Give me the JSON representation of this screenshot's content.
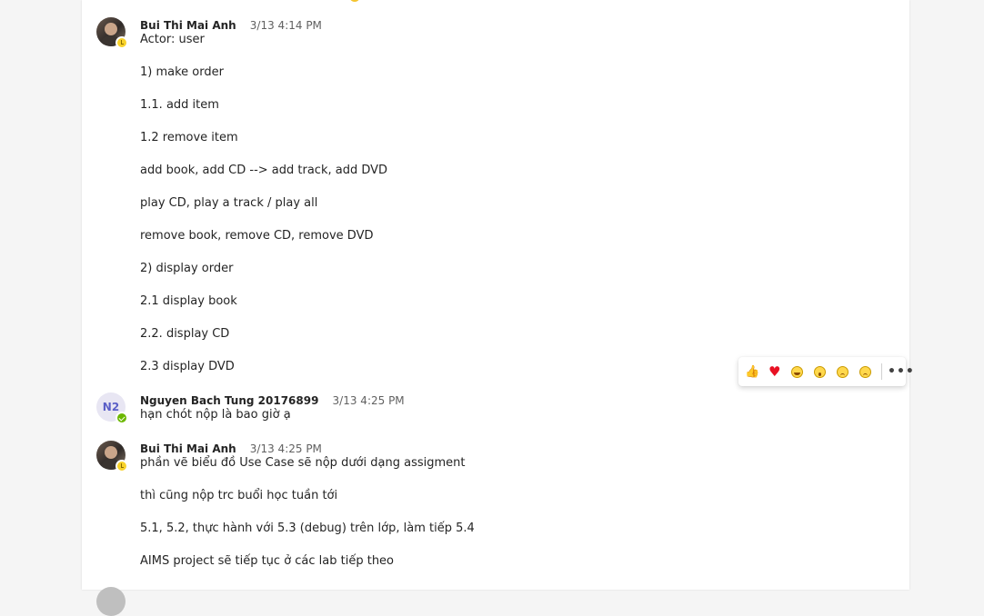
{
  "messages": [
    {
      "author": "Bui Thi Mai Anh",
      "time": "3/13 4:14 PM",
      "presence": "away",
      "lines": [
        "Actor: user",
        "1) make order",
        "1.1. add item",
        "1.2 remove item",
        "add book, add CD --> add track, add DVD",
        "play CD, play a track / play all",
        "remove book, remove CD, remove DVD",
        "2) display order",
        "2.1 display book",
        "2.2. display CD",
        "2.3 display DVD"
      ]
    },
    {
      "author": "Nguyen Bach Tung 20176899",
      "initials": "N2",
      "time": "3/13 4:25 PM",
      "presence": "available",
      "lines": [
        "hạn chót nộp là bao giờ ạ"
      ]
    },
    {
      "author": "Bui Thi Mai Anh",
      "time": "3/13 4:25 PM",
      "presence": "away",
      "lines": [
        "phần vẽ biểu đồ Use Case sẽ nộp dưới dạng assigment",
        "thì cũng nộp trc buổi học tuần tới",
        "5.1, 5.2, thực hành với 5.3 (debug) trên lớp, làm tiếp 5.4",
        "AIMS project sẽ tiếp tục ở các lab tiếp theo"
      ]
    }
  ],
  "reactions": {
    "like": "👍",
    "heart": "♥",
    "icons": [
      "like-icon",
      "heart-icon",
      "laugh-icon",
      "surprised-icon",
      "sad-icon",
      "angry-icon",
      "more-options-icon"
    ],
    "more": "•••",
    "heart_color": "#e81123"
  },
  "colors": {
    "accent": "#5b5fc7",
    "away": "#f8d22a",
    "available": "#6bb700"
  }
}
